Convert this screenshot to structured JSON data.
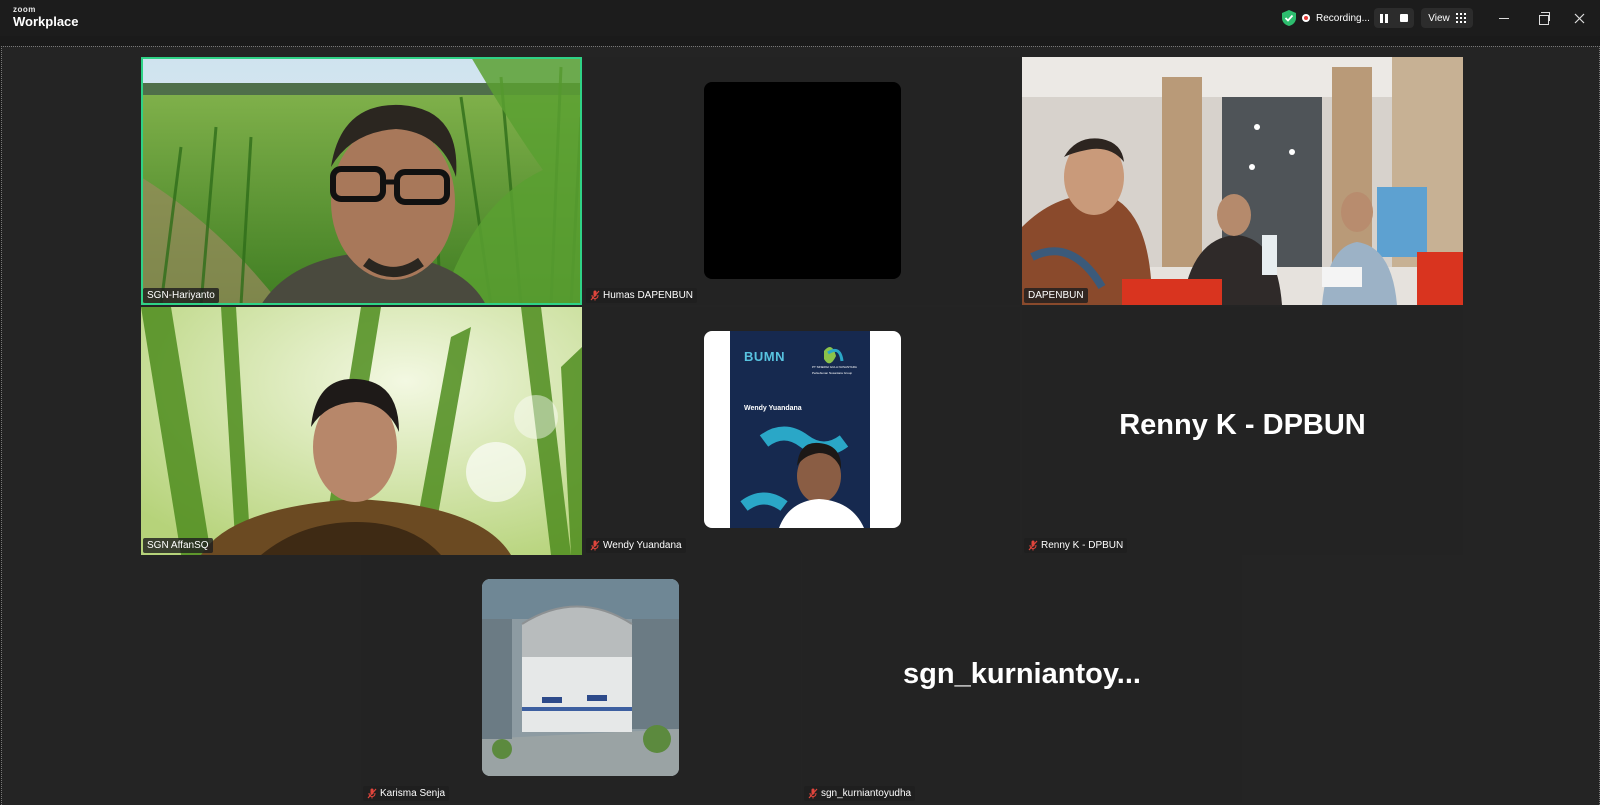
{
  "app": {
    "brand_top": "zoom",
    "brand_bottom": "Workplace"
  },
  "titlebar": {
    "recording_label": "Recording...",
    "view_label": "View"
  },
  "participants": [
    {
      "name": "SGN-Hariyanto",
      "muted": false,
      "active_speaker": true,
      "video": "on"
    },
    {
      "name": "Humas DAPENBUN",
      "muted": true,
      "video": "off"
    },
    {
      "name": "DAPENBUN",
      "muted": false,
      "video": "on"
    },
    {
      "name": "SGN AffanSQ",
      "muted": false,
      "video": "on"
    },
    {
      "name": "Wendy Yuandana",
      "muted": true,
      "video": "off",
      "avatar_text": {
        "logo": "BUMN",
        "company": "PT SINERGI GULA NUSANTARA",
        "sub": "Perkebunan Nusantara Group",
        "person": "Wendy Yuandana"
      }
    },
    {
      "name": "Renny K - DPBUN",
      "muted": true,
      "video": "off",
      "display_name": "Renny K - DPBUN"
    },
    {
      "name": "Karisma Senja",
      "muted": true,
      "video": "off"
    },
    {
      "name": "sgn_kurniantoyudha",
      "muted": true,
      "video": "off",
      "display_name": "sgn_kurniantoy..."
    }
  ],
  "colors": {
    "active_border": "#2fd286",
    "mute_red": "#e0453c",
    "shield_green": "#2dbd6e"
  }
}
